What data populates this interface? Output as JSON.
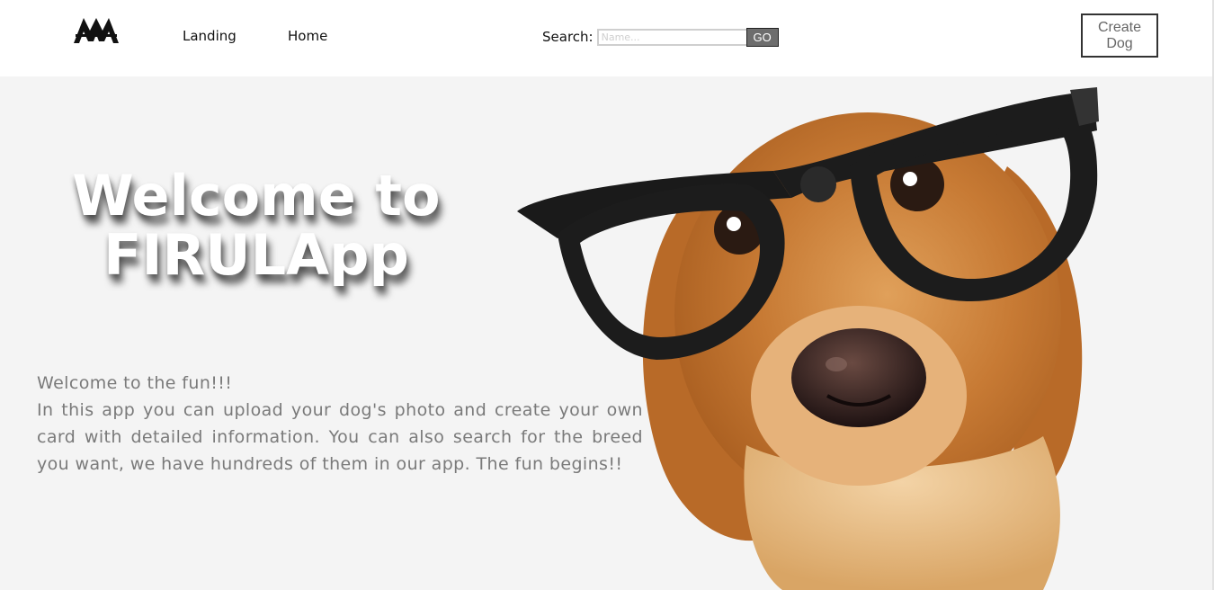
{
  "nav": {
    "logo_icon": "double-A-logo-icon",
    "landing_label": "Landing",
    "home_label": "Home"
  },
  "search": {
    "label": "Search:",
    "placeholder": "Name...",
    "value": "",
    "go_label": "GO"
  },
  "create_button": {
    "label": "Create\nDog"
  },
  "hero": {
    "title_line1": "Welcome to",
    "title_line2": "FIRULApp",
    "intro_line": "Welcome to the fun!!!",
    "description": "In this app you can upload your dog's photo and create your own card with detailed information. You can also search for the breed you want, we have hundreds of them in our app. The fun begins!!"
  },
  "colors": {
    "background": "#f4f4f4",
    "header": "#ffffff",
    "text_muted": "#7a7a7a",
    "go_button": "#6d6d6d"
  }
}
